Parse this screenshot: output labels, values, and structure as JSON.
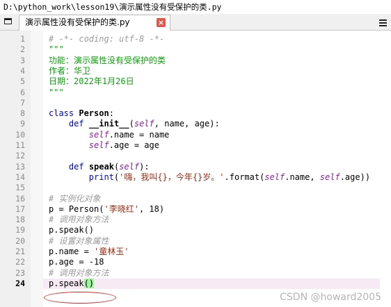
{
  "window": {
    "title": "D:\\python_work\\lesson19\\演示属性没有受保护的类.py"
  },
  "tab": {
    "label": "演示属性没有受保护的类.py",
    "close_glyph": "×"
  },
  "watermark": "CSDN @howard2005",
  "current_line": 24,
  "lines": [
    {
      "no": "1",
      "text": "# -*- coding: utf-8 -*-",
      "style": "comment"
    },
    {
      "no": "2",
      "text": "\"\"\"",
      "style": "green"
    },
    {
      "no": "3",
      "text": "功能：演示属性没有受保护的类",
      "style": "green"
    },
    {
      "no": "4",
      "text": "作者：华卫",
      "style": "green"
    },
    {
      "no": "5",
      "text": "日期：2022年1月26日",
      "style": "green"
    },
    {
      "no": "6",
      "text": "\"\"\"",
      "style": "green"
    },
    {
      "no": "7",
      "text": "",
      "style": "plain"
    },
    {
      "no": "8",
      "text": "class Person:",
      "style": "class"
    },
    {
      "no": "9",
      "text": "    def __init__(self, name, age):",
      "style": "def_init"
    },
    {
      "no": "10",
      "text": "        self.name = name",
      "style": "self_assign"
    },
    {
      "no": "11",
      "text": "        self.age = age",
      "style": "self_assign"
    },
    {
      "no": "12",
      "text": "",
      "style": "plain"
    },
    {
      "no": "13",
      "text": "    def speak(self):",
      "style": "def_speak"
    },
    {
      "no": "14",
      "text": "        print('嗨，我叫{}，今年{}岁。'.format(self.name, self.age))",
      "style": "print"
    },
    {
      "no": "15",
      "text": "",
      "style": "plain"
    },
    {
      "no": "16",
      "text": "# 实例化对象",
      "style": "comment"
    },
    {
      "no": "17",
      "text": "p = Person('李晓红', 18)",
      "style": "instantiate"
    },
    {
      "no": "18",
      "text": "# 调用对象方法",
      "style": "comment"
    },
    {
      "no": "19",
      "text": "p.speak()",
      "style": "plain"
    },
    {
      "no": "20",
      "text": "# 设置对象属性",
      "style": "comment"
    },
    {
      "no": "21",
      "text": "p.name = '童林玉'",
      "style": "assign_str"
    },
    {
      "no": "22",
      "text": "p.age = -18",
      "style": "plain"
    },
    {
      "no": "23",
      "text": "# 调用对象方法",
      "style": "comment"
    },
    {
      "no": "24",
      "text": "p.speak()",
      "style": "current"
    }
  ]
}
